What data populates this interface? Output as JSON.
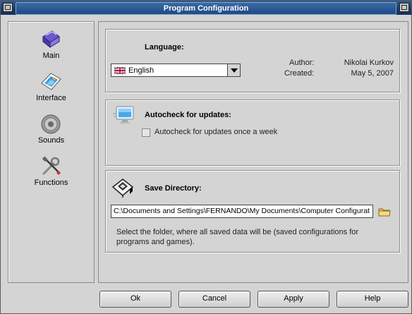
{
  "window": {
    "title": "Program Configuration"
  },
  "sidebar": {
    "items": [
      {
        "label": "Main",
        "icon": "main-icon"
      },
      {
        "label": "Interface",
        "icon": "interface-icon"
      },
      {
        "label": "Sounds",
        "icon": "sounds-icon"
      },
      {
        "label": "Functions",
        "icon": "functions-icon"
      }
    ]
  },
  "language": {
    "heading": "Language:",
    "selected": "English",
    "author_label": "Author:",
    "author_value": "Nikolai Kurkov",
    "created_label": "Created:",
    "created_value": "May 5, 2007"
  },
  "autocheck": {
    "heading": "Autocheck for updates:",
    "checkbox_label": "Autocheck for updates once a week",
    "checked": false
  },
  "save_directory": {
    "heading": "Save Directory:",
    "path": "C:\\Documents and Settings\\FERNANDO\\My Documents\\Computer Configurat",
    "description": "Select the folder, where all saved data will be (saved configurations for programs and games)."
  },
  "buttons": {
    "ok": "Ok",
    "cancel": "Cancel",
    "apply": "Apply",
    "help": "Help"
  },
  "colors": {
    "titlebar": "#1a3d6e",
    "background": "#d4d4d4"
  }
}
